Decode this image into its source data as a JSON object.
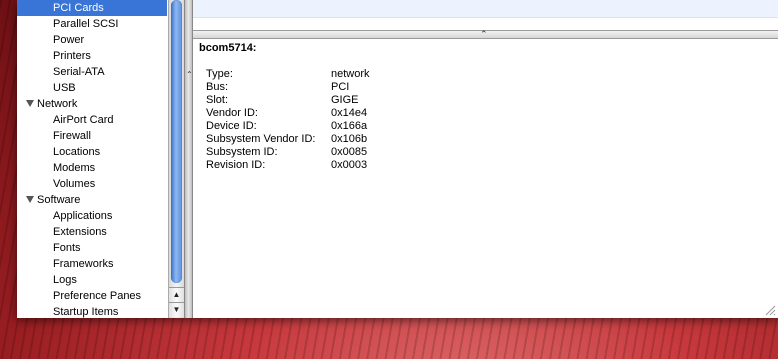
{
  "sidebar": {
    "items": [
      {
        "label": "PCI Cards",
        "level": "child",
        "selected": true
      },
      {
        "label": "Parallel SCSI",
        "level": "child"
      },
      {
        "label": "Power",
        "level": "child"
      },
      {
        "label": "Printers",
        "level": "child"
      },
      {
        "label": "Serial-ATA",
        "level": "child"
      },
      {
        "label": "USB",
        "level": "child"
      },
      {
        "label": "Network",
        "level": "parent",
        "expanded": true
      },
      {
        "label": "AirPort Card",
        "level": "child"
      },
      {
        "label": "Firewall",
        "level": "child"
      },
      {
        "label": "Locations",
        "level": "child"
      },
      {
        "label": "Modems",
        "level": "child"
      },
      {
        "label": "Volumes",
        "level": "child"
      },
      {
        "label": "Software",
        "level": "parent",
        "expanded": true
      },
      {
        "label": "Applications",
        "level": "child"
      },
      {
        "label": "Extensions",
        "level": "child"
      },
      {
        "label": "Fonts",
        "level": "child"
      },
      {
        "label": "Frameworks",
        "level": "child"
      },
      {
        "label": "Logs",
        "level": "child"
      },
      {
        "label": "Preference Panes",
        "level": "child"
      },
      {
        "label": "Startup Items",
        "level": "child"
      }
    ],
    "scroll_up_glyph": "▲",
    "scroll_down_glyph": "▼"
  },
  "details": {
    "title": "bcom5714:",
    "properties": [
      {
        "label": "Type:",
        "value": "network"
      },
      {
        "label": "Bus:",
        "value": "PCI"
      },
      {
        "label": "Slot:",
        "value": "GIGE"
      },
      {
        "label": "Vendor ID:",
        "value": "0x14e4"
      },
      {
        "label": "Device ID:",
        "value": "0x166a"
      },
      {
        "label": "Subsystem Vendor ID:",
        "value": "0x106b"
      },
      {
        "label": "Subsystem ID:",
        "value": "0x0085"
      },
      {
        "label": "Revision ID:",
        "value": "0x0003"
      }
    ]
  },
  "splitters": {
    "horizontal_grip": "⌃",
    "vertical_grip": "⌃"
  },
  "colors": {
    "selection": "#3875d7",
    "wallpaper": "#9a1e22",
    "row_stripe": "#edf3fe"
  },
  "icons": {
    "disclosure": "disclosure-triangle-icon",
    "resize": "resize-grip-icon"
  }
}
